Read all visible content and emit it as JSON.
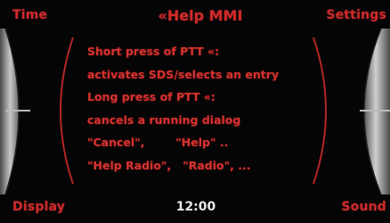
{
  "header": {
    "title": "«Help MMI"
  },
  "softkeys": {
    "top_left": "Time",
    "top_right": "Settings",
    "bottom_left": "Display",
    "bottom_right": "Sound"
  },
  "status": {
    "clock": "12:00"
  },
  "help": {
    "lines": [
      "Short press of PTT «:",
      "activates SDS/selects an entry",
      "Long press of PTT «:",
      "cancels a running dialog",
      "\"Cancel\",        \"Help\" ..",
      "\"Help Radio\",   \"Radio\", ..."
    ]
  },
  "colors": {
    "accent_red": "#d6322e",
    "clock_white": "#e9e9e9",
    "background": "#050506",
    "bezel_grey": "#9a9a9a"
  }
}
